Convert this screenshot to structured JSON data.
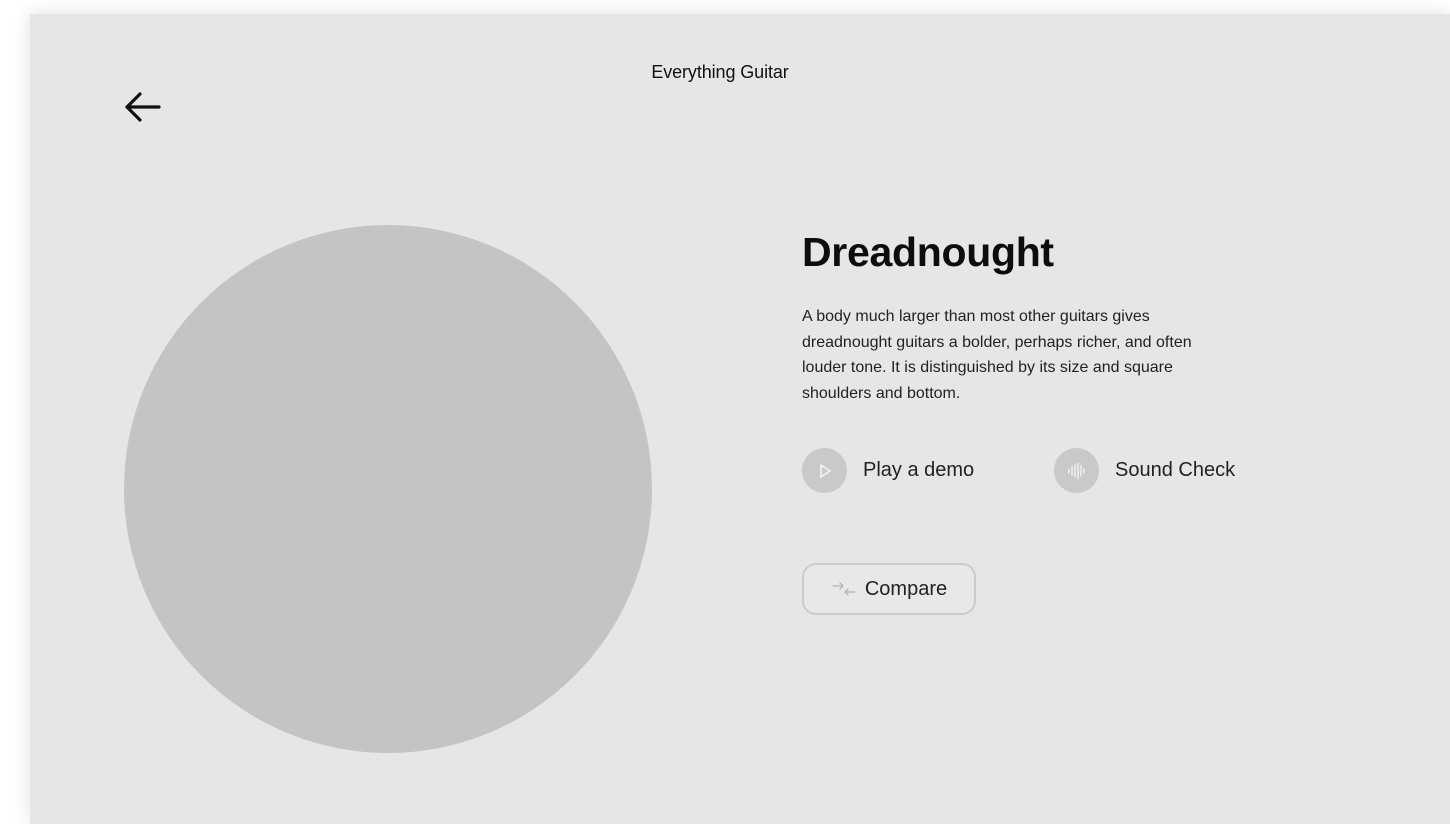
{
  "header": {
    "title": "Everything Guitar"
  },
  "nav": {
    "back_icon": "arrow-left-icon"
  },
  "product": {
    "title": "Dreadnought",
    "description": "A body much larger than most other guitars gives dreadnought guitars a bolder, perhaps richer, and often louder tone. It is distinguished by its size and square shoulders and bottom."
  },
  "actions": {
    "play_label": "Play a demo",
    "play_icon": "play-icon",
    "sound_label": "Sound Check",
    "sound_icon": "sound-wave-icon",
    "compare_label": "Compare",
    "compare_icon": "compare-arrows-icon"
  },
  "colors": {
    "background": "#e6e6e6",
    "placeholder": "#c4c4c4",
    "icon_circle": "#c9c9c9",
    "text": "#222222"
  }
}
